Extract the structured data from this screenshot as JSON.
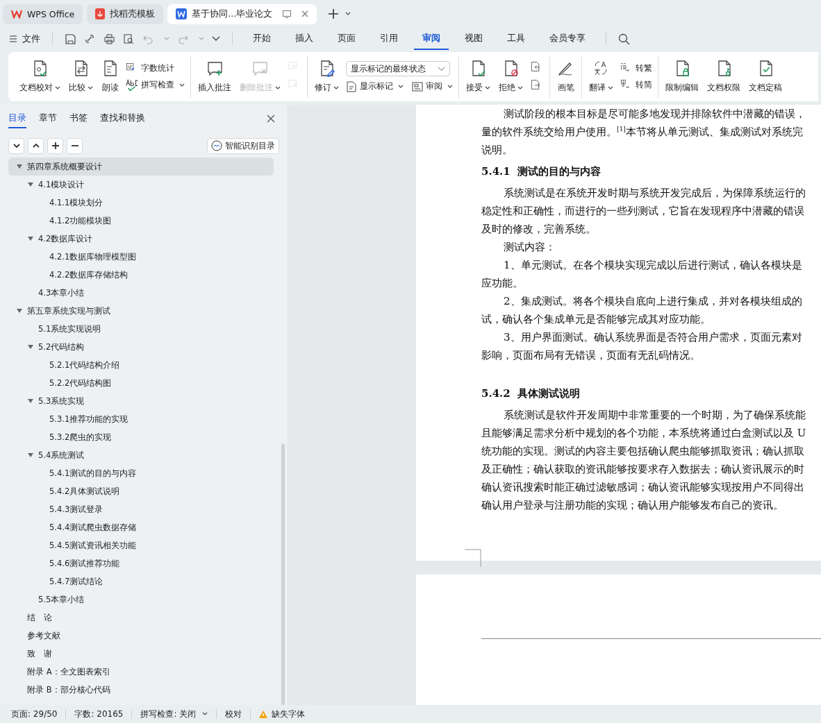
{
  "app_tabs": [
    {
      "kind": "brand",
      "label": "WPS Office",
      "selected": false
    },
    {
      "kind": "template",
      "label": "找稻壳模板",
      "selected": false
    },
    {
      "kind": "doc",
      "label": "基于协同...毕业论文",
      "selected": true
    }
  ],
  "menu": {
    "file": "文件",
    "tabs": [
      {
        "label": "开始",
        "selected": false
      },
      {
        "label": "插入",
        "selected": false
      },
      {
        "label": "页面",
        "selected": false
      },
      {
        "label": "引用",
        "selected": false
      },
      {
        "label": "审阅",
        "selected": true
      },
      {
        "label": "视图",
        "selected": false
      },
      {
        "label": "工具",
        "selected": false
      },
      {
        "label": "会员专享",
        "selected": false
      }
    ]
  },
  "ribbon": {
    "groups": [
      {
        "columns": [
          [
            {
              "kind": "large",
              "label": "文档校对",
              "dropdown": true,
              "disabled": false
            }
          ],
          [
            {
              "kind": "large",
              "label": "比较",
              "dropdown": true,
              "disabled": false
            }
          ],
          [
            {
              "kind": "large",
              "label": "朗读",
              "dropdown": false,
              "disabled": false
            }
          ],
          [
            {
              "kind": "small",
              "label": "字数统计",
              "dropdown": false,
              "disabled": false
            },
            {
              "kind": "small",
              "label": "拼写检查",
              "dropdown": true,
              "disabled": false
            }
          ]
        ]
      },
      {
        "columns": [
          [
            {
              "kind": "large",
              "label": "插入批注",
              "dropdown": false,
              "disabled": false
            }
          ],
          [
            {
              "kind": "large",
              "label": "删除批注",
              "dropdown": true,
              "disabled": true
            }
          ],
          [
            {
              "kind": "icon",
              "disabled": true
            },
            {
              "kind": "icon",
              "disabled": true
            }
          ]
        ]
      },
      {
        "columns": [
          [
            {
              "kind": "large",
              "label": "修订",
              "dropdown": true,
              "disabled": false
            }
          ],
          [
            {
              "kind": "select",
              "label": "显示标记的最终状态"
            },
            {
              "kind": "pair",
              "items": [
                {
                  "label": "显示标记",
                  "dropdown": true
                },
                {
                  "label": "审阅",
                  "dropdown": true
                }
              ]
            }
          ]
        ]
      },
      {
        "columns": [
          [
            {
              "kind": "large",
              "label": "接受",
              "dropdown": true,
              "disabled": false
            }
          ],
          [
            {
              "kind": "large",
              "label": "拒绝",
              "dropdown": true,
              "disabled": false
            }
          ],
          [
            {
              "kind": "icon",
              "disabled": false
            },
            {
              "kind": "icon",
              "disabled": false
            }
          ]
        ]
      },
      {
        "columns": [
          [
            {
              "kind": "large",
              "label": "画笔",
              "dropdown": false,
              "disabled": false
            }
          ]
        ]
      },
      {
        "columns": [
          [
            {
              "kind": "large",
              "label": "翻译",
              "dropdown": true,
              "disabled": false
            }
          ],
          [
            {
              "kind": "small",
              "label": "转繁",
              "dropdown": false,
              "disabled": false
            },
            {
              "kind": "small",
              "label": "转简",
              "dropdown": false,
              "disabled": false
            }
          ]
        ]
      },
      {
        "columns": [
          [
            {
              "kind": "large",
              "label": "限制编辑",
              "dropdown": false,
              "disabled": false
            }
          ],
          [
            {
              "kind": "large",
              "label": "文档权限",
              "dropdown": false,
              "disabled": false
            }
          ],
          [
            {
              "kind": "large",
              "label": "文档定稿",
              "dropdown": false,
              "disabled": false
            }
          ]
        ]
      }
    ]
  },
  "sidebar": {
    "tabs": [
      {
        "label": "目录",
        "selected": true
      },
      {
        "label": "章节",
        "selected": false
      },
      {
        "label": "书签",
        "selected": false
      },
      {
        "label": "查找和替换",
        "selected": false
      }
    ],
    "smart_button": "智能识别目录",
    "toc": [
      {
        "label": "第四章系统概要设计",
        "expanded": true,
        "selected": true,
        "children": [
          {
            "label": "4.1模块设计",
            "expanded": true,
            "selected": false,
            "children": [
              {
                "label": "4.1.1模块划分",
                "selected": false
              },
              {
                "label": "4.1.2功能模块图",
                "selected": false
              }
            ]
          },
          {
            "label": "4.2数据库设计",
            "expanded": true,
            "selected": false,
            "children": [
              {
                "label": "4.2.1数据库物理模型图",
                "selected": false
              },
              {
                "label": "4.2.2数据库存储结构",
                "selected": false
              }
            ]
          },
          {
            "label": "4.3本章小结",
            "selected": false
          }
        ]
      },
      {
        "label": "第五章系统实现与测试",
        "expanded": true,
        "selected": false,
        "children": [
          {
            "label": "5.1系统实现说明",
            "selected": false
          },
          {
            "label": "5.2代码结构",
            "expanded": true,
            "selected": false,
            "children": [
              {
                "label": "5.2.1代码结构介绍",
                "selected": false
              },
              {
                "label": "5.2.2代码结构图",
                "selected": false
              }
            ]
          },
          {
            "label": "5.3系统实现",
            "expanded": true,
            "selected": false,
            "children": [
              {
                "label": "5.3.1推荐功能的实现",
                "selected": false
              },
              {
                "label": "5.3.2爬虫的实现",
                "selected": false
              }
            ]
          },
          {
            "label": "5.4系统测试",
            "expanded": true,
            "selected": false,
            "children": [
              {
                "label": "5.4.1测试的目的与内容",
                "selected": false
              },
              {
                "label": "5.4.2具体测试说明",
                "selected": false
              },
              {
                "label": "5.4.3测试登录",
                "selected": false
              },
              {
                "label": "5.4.4测试爬虫数据存储",
                "selected": false
              },
              {
                "label": "5.4.5测试资讯相关功能",
                "selected": false
              },
              {
                "label": "5.4.6测试推荐功能",
                "selected": false
              },
              {
                "label": "5.4.7测试结论",
                "selected": false
              }
            ]
          },
          {
            "label": "5.5本章小结",
            "selected": false
          }
        ]
      },
      {
        "label": "结　论",
        "selected": false
      },
      {
        "label": "参考文献",
        "selected": false
      },
      {
        "label": "致　谢",
        "selected": false
      },
      {
        "label": "附录 A：全文图表索引",
        "selected": false
      },
      {
        "label": "附录 B：部分核心代码",
        "selected": false
      }
    ]
  },
  "document": {
    "lines": [
      {
        "kind": "first",
        "text": "测试阶段的根本目标是尽可能多地发现并排除软件中潜藏的错误，"
      },
      {
        "kind": "cont",
        "text": "量的软件系统交给用户使用。$^{[1]}$本节将从单元测试、集成测试对系统完"
      },
      {
        "kind": "cont",
        "text": "说明。"
      },
      {
        "kind": "heading",
        "number": "5.4.1",
        "text": "测试的目的与内容"
      },
      {
        "kind": "first",
        "text": "系统测试是在系统开发时期与系统开发完成后，为保障系统运行的"
      },
      {
        "kind": "cont",
        "text": "稳定性和正确性，而进行的一些列测试，它旨在发现程序中潜藏的错误"
      },
      {
        "kind": "cont",
        "text": "及时的修改，完善系统。"
      },
      {
        "kind": "first",
        "text": "测试内容："
      },
      {
        "kind": "first",
        "text": "1、单元测试。在各个模块实现完成以后进行测试，确认各模块是"
      },
      {
        "kind": "cont",
        "text": "应功能。"
      },
      {
        "kind": "first",
        "text": "2、集成测试。将各个模块自底向上进行集成，并对各模块组成的"
      },
      {
        "kind": "cont",
        "text": "试，确认各个集成单元是否能够完成其对应功能。"
      },
      {
        "kind": "first",
        "text": "3、用户界面测试。确认系统界面是否符合用户需求，页面元素对"
      },
      {
        "kind": "cont",
        "text": "影响，页面布局有无错误，页面有无乱码情况。"
      },
      {
        "kind": "gap"
      },
      {
        "kind": "heading",
        "number": "5.4.2",
        "text": "具体测试说明"
      },
      {
        "kind": "first",
        "text": "系统测试是软件开发周期中非常重要的一个时期，为了确保系统能"
      },
      {
        "kind": "cont",
        "text": "且能够满足需求分析中规划的各个功能，本系统将通过白盒测试以及 U"
      },
      {
        "kind": "cont",
        "text": "统功能的实现。测试的内容主要包括确认爬虫能够抓取资讯；确认抓取"
      },
      {
        "kind": "cont",
        "text": "及正确性；确认获取的资讯能够按要求存入数据去；确认资讯展示的时"
      },
      {
        "kind": "cont",
        "text": "确认资讯搜索时能正确过滤敏感词；确认资讯能够实现按用户不同得出"
      },
      {
        "kind": "cont",
        "text": "确认用户登录与注册功能的实现；确认用户能够发布自己的资讯。"
      }
    ]
  },
  "status_bar": [
    {
      "kind": "text",
      "label": "页面: 29/50"
    },
    {
      "kind": "text",
      "label": "字数: 20165"
    },
    {
      "kind": "dropdown",
      "label": "拼写检查: 关闭"
    },
    {
      "kind": "text",
      "label": "校对"
    },
    {
      "kind": "warning",
      "label": "缺失字体"
    }
  ]
}
